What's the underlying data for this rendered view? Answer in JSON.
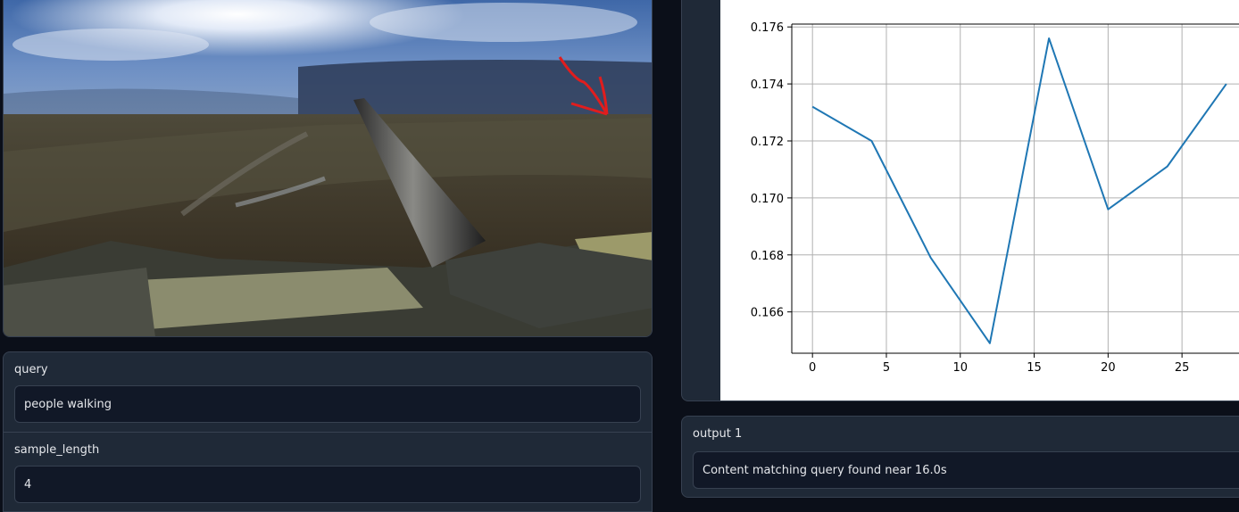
{
  "input": {
    "query_label": "query",
    "query_value": "people walking",
    "sample_length_label": "sample_length",
    "sample_length_value": "4"
  },
  "output": {
    "label": "output 1",
    "value": "Content matching query found near 16.0s"
  },
  "colors": {
    "line": "#1f77b4",
    "panel": "#1f2937",
    "background": "#0b0f19",
    "annotation_arrow": "#e11d1d"
  },
  "chart_data": {
    "type": "line",
    "x": [
      0,
      4,
      8,
      12,
      16,
      20,
      24,
      28
    ],
    "values": [
      0.1732,
      0.172,
      0.1679,
      0.1649,
      0.1756,
      0.1696,
      0.1711,
      0.174
    ],
    "xticks": [
      "0",
      "5",
      "10",
      "15",
      "20",
      "25"
    ],
    "yticks": [
      "0.166",
      "0.168",
      "0.170",
      "0.172",
      "0.174",
      "0.176"
    ],
    "xlim": [
      -1.4,
      29.4
    ],
    "ylim": [
      0.16455,
      0.1761
    ],
    "grid": true
  }
}
